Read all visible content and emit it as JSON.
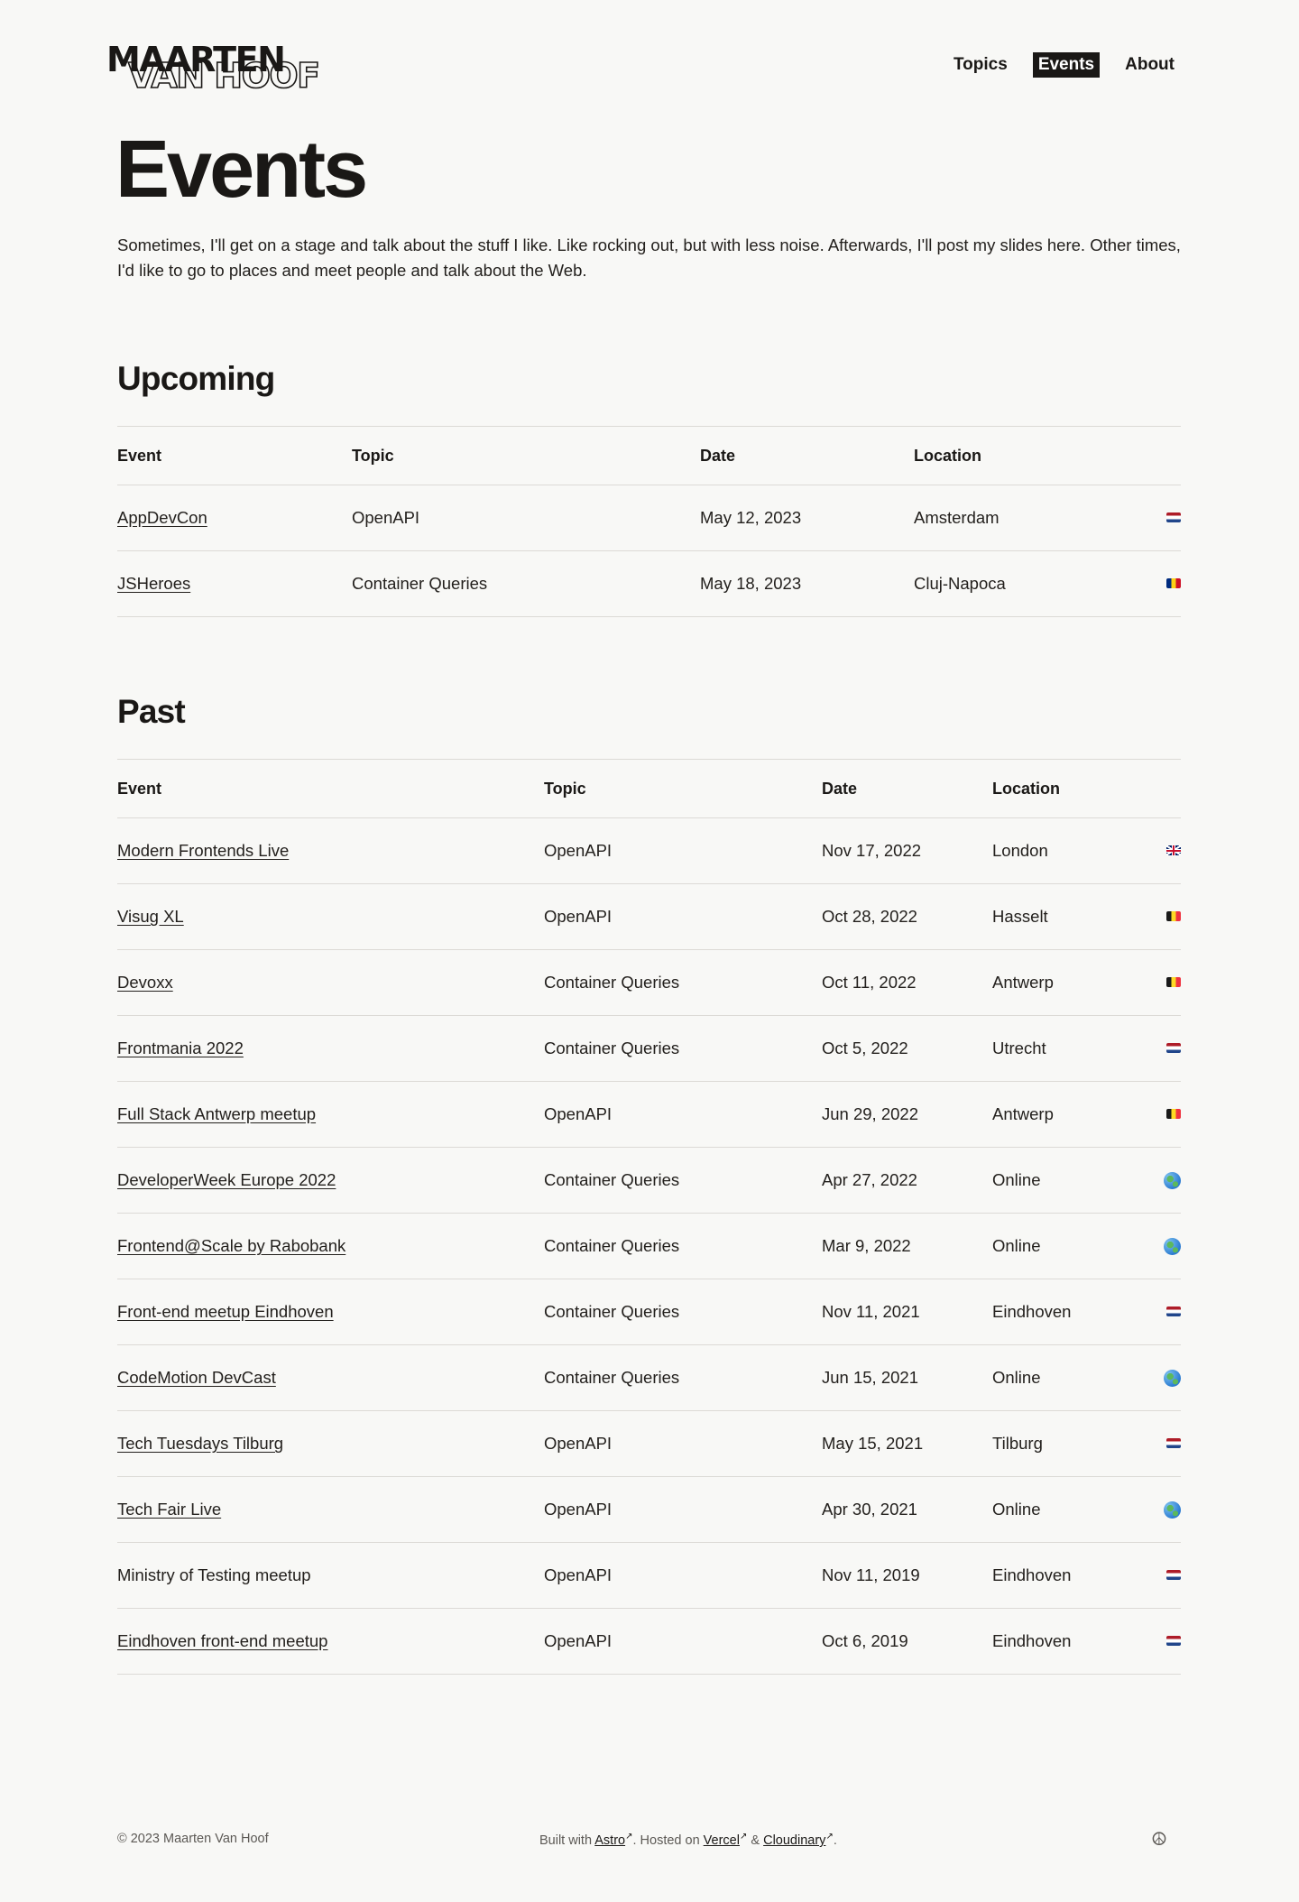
{
  "header": {
    "logo_line1": "MAARTEN",
    "logo_line2": "VAN HOOF",
    "nav": [
      {
        "label": "Topics",
        "active": false
      },
      {
        "label": "Events",
        "active": true
      },
      {
        "label": "About",
        "active": false
      }
    ]
  },
  "page": {
    "title": "Events",
    "intro": "Sometimes, I'll get on a stage and talk about the stuff I like. Like rocking out, but with less noise. Afterwards, I'll post my slides here. Other times, I'd like to go to places and meet people and talk about the Web."
  },
  "columns": {
    "event": "Event",
    "topic": "Topic",
    "date": "Date",
    "location": "Location"
  },
  "upcoming": {
    "title": "Upcoming",
    "rows": [
      {
        "event": "AppDevCon",
        "topic": "OpenAPI",
        "date": "May 12, 2023",
        "location": "Amsterdam",
        "flag": "nl-flag-icon"
      },
      {
        "event": "JSHeroes",
        "topic": "Container Queries",
        "date": "May 18, 2023",
        "location": "Cluj-Napoca",
        "flag": "ro-flag-icon"
      }
    ]
  },
  "past": {
    "title": "Past",
    "rows": [
      {
        "event": "Modern Frontends Live",
        "topic": "OpenAPI",
        "date": "Nov 17, 2022",
        "location": "London",
        "flag": "gb-flag-icon"
      },
      {
        "event": "Visug XL",
        "topic": "OpenAPI",
        "date": "Oct 28, 2022",
        "location": "Hasselt",
        "flag": "be-flag-icon"
      },
      {
        "event": "Devoxx",
        "topic": "Container Queries",
        "date": "Oct 11, 2022",
        "location": "Antwerp",
        "flag": "be-flag-icon"
      },
      {
        "event": "Frontmania 2022",
        "topic": "Container Queries",
        "date": "Oct 5, 2022",
        "location": "Utrecht",
        "flag": "nl-flag-icon"
      },
      {
        "event": "Full Stack Antwerp meetup",
        "topic": "OpenAPI",
        "date": "Jun 29, 2022",
        "location": "Antwerp",
        "flag": "be-flag-icon"
      },
      {
        "event": "DeveloperWeek Europe 2022",
        "topic": "Container Queries",
        "date": "Apr 27, 2022",
        "location": "Online",
        "flag": "globe-icon"
      },
      {
        "event": "Frontend@Scale by Rabobank",
        "topic": "Container Queries",
        "date": "Mar 9, 2022",
        "location": "Online",
        "flag": "globe-icon"
      },
      {
        "event": "Front-end meetup Eindhoven",
        "topic": "Container Queries",
        "date": "Nov 11, 2021",
        "location": "Eindhoven",
        "flag": "nl-flag-icon"
      },
      {
        "event": "CodeMotion DevCast",
        "topic": "Container Queries",
        "date": "Jun 15, 2021",
        "location": "Online",
        "flag": "globe-icon"
      },
      {
        "event": "Tech Tuesdays Tilburg",
        "topic": "OpenAPI",
        "date": "May 15, 2021",
        "location": "Tilburg",
        "flag": "nl-flag-icon"
      },
      {
        "event": "Tech Fair Live",
        "topic": "OpenAPI",
        "date": "Apr 30, 2021",
        "location": "Online",
        "flag": "globe-icon"
      },
      {
        "event": "Ministry of Testing meetup",
        "topic": "OpenAPI",
        "date": "Nov 11, 2019",
        "location": "Eindhoven",
        "flag": "nl-flag-icon",
        "linked": false
      },
      {
        "event": "Eindhoven front-end meetup",
        "topic": "OpenAPI",
        "date": "Oct 6, 2019",
        "location": "Eindhoven",
        "flag": "nl-flag-icon"
      }
    ]
  },
  "footer": {
    "copyright": "© 2023 Maarten Van Hoof",
    "built_with": "Built with ",
    "astro": "Astro",
    "hosted_on": ". Hosted on ",
    "vercel": "Vercel",
    "amp": " & ",
    "cloudinary": "Cloudinary",
    "period": ".",
    "peace": "☮"
  },
  "colors": {
    "background": "#f8f8f6",
    "text": "#1a1816",
    "rule": "#dcdad6"
  }
}
